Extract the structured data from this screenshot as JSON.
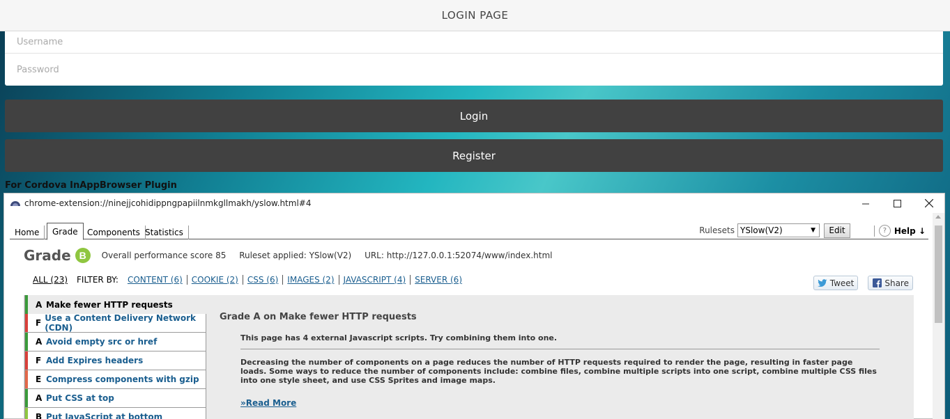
{
  "app": {
    "header_title": "LOGIN PAGE",
    "username_placeholder": "Username",
    "password_placeholder": "Password",
    "login_label": "Login",
    "register_label": "Register",
    "cordova_note": "For Cordova InAppBrowser Plugin"
  },
  "window": {
    "title": "chrome-extension://ninejjcohidippngpapiilnmkgllmakh/yslow.html#4"
  },
  "yslow": {
    "tabs": [
      {
        "label": "Home"
      },
      {
        "label": "Grade"
      },
      {
        "label": "Components"
      },
      {
        "label": "Statistics"
      }
    ],
    "active_tab": "Grade",
    "rulesets_label": "Rulesets",
    "ruleset_selected": "YSlow(V2)",
    "edit_label": "Edit",
    "help_label": "Help ↓",
    "grade_word": "Grade",
    "grade_letter": "B",
    "overall_score": "Overall performance score 85",
    "ruleset_applied": "Ruleset applied: YSlow(V2)",
    "url": "URL: http://127.0.0.1:52074/www/index.html",
    "filter": {
      "all_label": "ALL (23)",
      "filter_by_label": "FILTER BY:",
      "links": [
        {
          "label": "CONTENT (6)"
        },
        {
          "label": "COOKIE (2)"
        },
        {
          "label": "CSS (6)"
        },
        {
          "label": "IMAGES (2)"
        },
        {
          "label": "JAVASCRIPT (4)"
        },
        {
          "label": "SERVER (6)"
        }
      ]
    },
    "tweet_label": "Tweet",
    "share_label": "Share",
    "rules": [
      {
        "grade": "A",
        "name": "Make fewer HTTP requests",
        "color": "#3a9a3a"
      },
      {
        "grade": "F",
        "name": "Use a Content Delivery Network (CDN)",
        "color": "#d9403a"
      },
      {
        "grade": "A",
        "name": "Avoid empty src or href",
        "color": "#3a9a3a"
      },
      {
        "grade": "F",
        "name": "Add Expires headers",
        "color": "#d9403a"
      },
      {
        "grade": "E",
        "name": "Compress components with gzip",
        "color": "#e2684a"
      },
      {
        "grade": "A",
        "name": "Put CSS at top",
        "color": "#3a9a3a"
      },
      {
        "grade": "B",
        "name": "Put JavaScript at bottom",
        "color": "#8fc640"
      }
    ],
    "detail": {
      "title": "Grade A on Make fewer HTTP requests",
      "summary": "This page has 4 external Javascript scripts. Try combining them into one.",
      "description": "Decreasing the number of components on a page reduces the number of HTTP requests required to render the page, resulting in faster page loads. Some ways to reduce the number of components include: combine files, combine multiple scripts into one script, combine multiple CSS files into one style sheet, and use CSS Sprites and image maps.",
      "read_more": "»Read More"
    }
  }
}
